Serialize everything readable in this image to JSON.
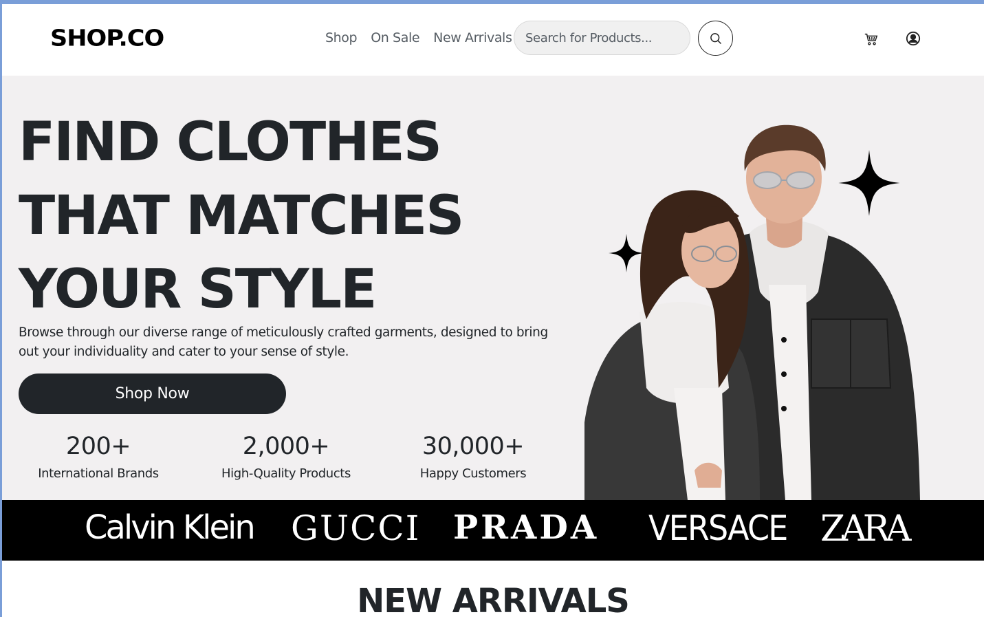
{
  "navbar": {
    "logo": "SHOP.CO",
    "links": [
      "Shop",
      "On Sale",
      "New Arrivals"
    ],
    "search_placeholder": "Search for Products...",
    "icons": {
      "search": "search-icon",
      "cart": "cart-icon",
      "user": "user-circle-icon"
    }
  },
  "hero": {
    "title_lines": [
      "FIND CLOTHES",
      "THAT MATCHES",
      "YOUR STYLE"
    ],
    "description": "Browse through our diverse range of meticulously crafted garments, designed to bring out your individuality and cater to your sense of style.",
    "cta_label": "Shop Now",
    "stats": [
      {
        "value": "200+",
        "label": "International Brands"
      },
      {
        "value": "2,000+",
        "label": "High-Quality Products"
      },
      {
        "value": "30,000+",
        "label": "Happy Customers"
      }
    ],
    "background_color": "#f2f0f1"
  },
  "brands": [
    "Calvin Klein",
    "GUCCI",
    "PRADA",
    "VERSACE",
    "ZARA"
  ],
  "new_arrivals": {
    "title": "NEW ARRIVALS"
  },
  "colors": {
    "primary": "#212529",
    "brand_bar": "#000000",
    "window_frame": "#7a9ed8"
  }
}
